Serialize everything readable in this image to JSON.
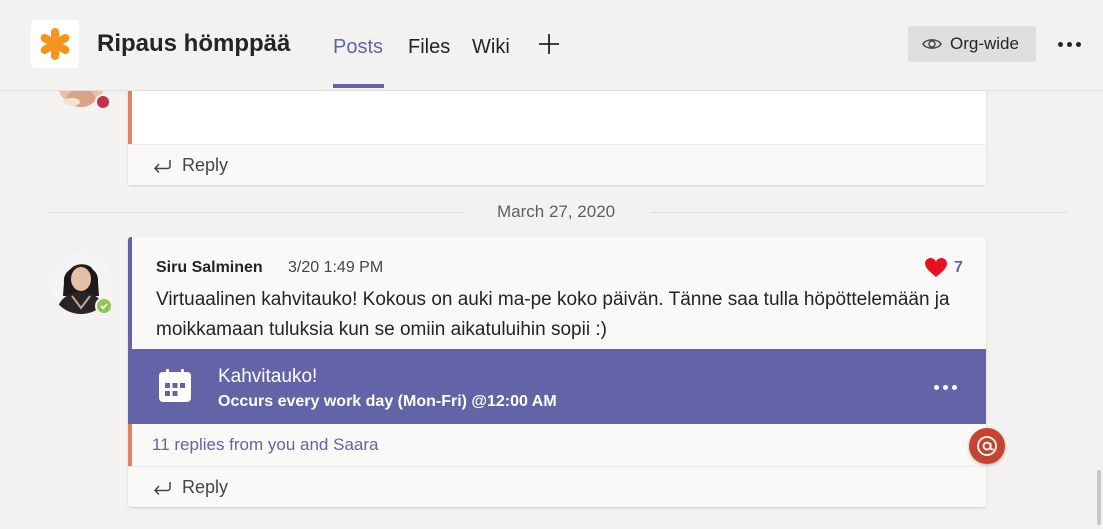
{
  "header": {
    "team_name": "Ripaus hömppää",
    "tabs": [
      {
        "label": "Posts",
        "active": true
      },
      {
        "label": "Files",
        "active": false
      },
      {
        "label": "Wiki",
        "active": false
      }
    ],
    "add_tab_icon": "plus-icon",
    "org_label": "Org-wide",
    "org_icon": "eye-icon",
    "more_icon": "more-options-icon"
  },
  "thread1": {
    "reply_label": "Reply",
    "status_color": "#c4314b"
  },
  "date_divider": "March 27, 2020",
  "thread2": {
    "author": "Siru Salminen",
    "timestamp": "3/20 1:49 PM",
    "reaction_icon": "heart-icon",
    "reaction_count": "7",
    "message": "Virtuaalinen kahvitauko! Kokous on auki ma-pe koko päivän. Tänne saa tulla höpöttelemään ja moikkamaan tuluksia kun se omiin aikatuluihin sopii :)",
    "event": {
      "icon": "calendar-icon",
      "title": "Kahvitauko!",
      "subtitle": "Occurs every work day (Mon-Fri) @12:00 AM"
    },
    "replies_summary": "11 replies from you and Saara",
    "reply_label": "Reply",
    "status_color": "#92c353"
  },
  "colors": {
    "accent": "#6264a7",
    "orange_accent": "#e3805e",
    "mention": "#c4442f",
    "logo": "#f7941d"
  }
}
